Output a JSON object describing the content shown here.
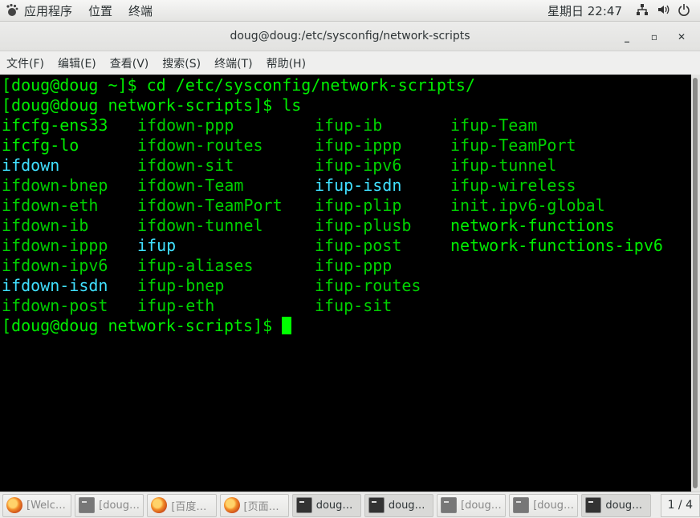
{
  "top_panel": {
    "apps_label": "应用程序",
    "places_label": "位置",
    "terminal_label": "终端",
    "clock": "星期日 22:47"
  },
  "window": {
    "title": "doug@doug:/etc/sysconfig/network-scripts",
    "minimize": "_",
    "maximize": "▫",
    "close": "✕"
  },
  "menubar": {
    "items": [
      "文件(F)",
      "编辑(E)",
      "查看(V)",
      "搜索(S)",
      "终端(T)",
      "帮助(H)"
    ]
  },
  "terminal": {
    "line1": "[doug@doug ~]$ cd /etc/sysconfig/network-scripts/",
    "line2": "[doug@doug network-scripts]$ ls",
    "prompt_last": "[doug@doug network-scripts]$ ",
    "ls_rows": [
      [
        {
          "t": "ifcfg-ens33",
          "c": "bright"
        },
        {
          "t": "ifdown-ppp",
          "c": "green"
        },
        {
          "t": "ifup-ib",
          "c": "green"
        },
        {
          "t": "ifup-Team",
          "c": "green"
        }
      ],
      [
        {
          "t": "ifcfg-lo",
          "c": "bright"
        },
        {
          "t": "ifdown-routes",
          "c": "green"
        },
        {
          "t": "ifup-ippp",
          "c": "green"
        },
        {
          "t": "ifup-TeamPort",
          "c": "green"
        }
      ],
      [
        {
          "t": "ifdown",
          "c": "cyan"
        },
        {
          "t": "ifdown-sit",
          "c": "green"
        },
        {
          "t": "ifup-ipv6",
          "c": "green"
        },
        {
          "t": "ifup-tunnel",
          "c": "green"
        }
      ],
      [
        {
          "t": "ifdown-bnep",
          "c": "green"
        },
        {
          "t": "ifdown-Team",
          "c": "green"
        },
        {
          "t": "ifup-isdn",
          "c": "cyan"
        },
        {
          "t": "ifup-wireless",
          "c": "green"
        }
      ],
      [
        {
          "t": "ifdown-eth",
          "c": "green"
        },
        {
          "t": "ifdown-TeamPort",
          "c": "green"
        },
        {
          "t": "ifup-plip",
          "c": "green"
        },
        {
          "t": "init.ipv6-global",
          "c": "green"
        }
      ],
      [
        {
          "t": "ifdown-ib",
          "c": "green"
        },
        {
          "t": "ifdown-tunnel",
          "c": "green"
        },
        {
          "t": "ifup-plusb",
          "c": "green"
        },
        {
          "t": "network-functions",
          "c": "bright"
        }
      ],
      [
        {
          "t": "ifdown-ippp",
          "c": "green"
        },
        {
          "t": "ifup",
          "c": "cyan"
        },
        {
          "t": "ifup-post",
          "c": "green"
        },
        {
          "t": "network-functions-ipv6",
          "c": "bright"
        }
      ],
      [
        {
          "t": "ifdown-ipv6",
          "c": "green"
        },
        {
          "t": "ifup-aliases",
          "c": "green"
        },
        {
          "t": "ifup-ppp",
          "c": "green"
        },
        {
          "t": "",
          "c": "green"
        }
      ],
      [
        {
          "t": "ifdown-isdn",
          "c": "cyan"
        },
        {
          "t": "ifup-bnep",
          "c": "green"
        },
        {
          "t": "ifup-routes",
          "c": "green"
        },
        {
          "t": "",
          "c": "green"
        }
      ],
      [
        {
          "t": "ifdown-post",
          "c": "green"
        },
        {
          "t": "ifup-eth",
          "c": "green"
        },
        {
          "t": "ifup-sit",
          "c": "green"
        },
        {
          "t": "",
          "c": "green"
        }
      ]
    ]
  },
  "taskbar": {
    "tasks": [
      {
        "label": "[Welc…",
        "icon": "firefox-icon",
        "active": false
      },
      {
        "label": "[doug…",
        "icon": "terminal-icon",
        "active": false
      },
      {
        "label": "[百度…",
        "icon": "firefox-icon",
        "active": false
      },
      {
        "label": "[页面…",
        "icon": "firefox-icon",
        "active": false
      },
      {
        "label": "doug…",
        "icon": "terminal-icon",
        "active": true
      },
      {
        "label": "doug…",
        "icon": "terminal-icon",
        "active": true
      },
      {
        "label": "[doug…",
        "icon": "terminal-icon",
        "active": false
      },
      {
        "label": "[doug…",
        "icon": "terminal-icon",
        "active": false
      },
      {
        "label": "doug…",
        "icon": "terminal-icon",
        "active": true
      }
    ],
    "workspace": "1 / 4"
  }
}
